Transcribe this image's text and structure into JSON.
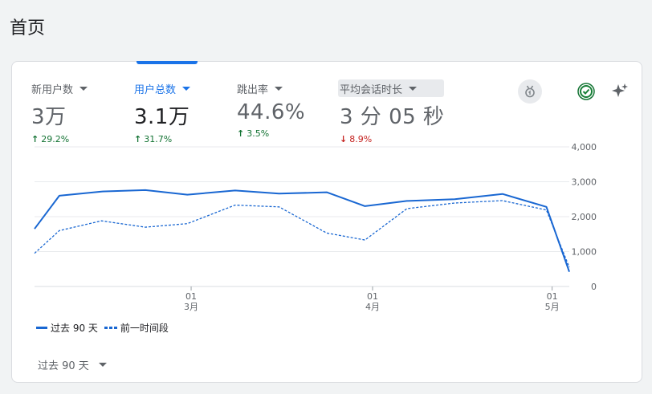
{
  "page": {
    "title": "首页"
  },
  "metrics": [
    {
      "label": "新用户数",
      "value": "3万",
      "change": "29.2%",
      "direction": "up"
    },
    {
      "label": "用户总数",
      "value": "3.1万",
      "change": "31.7%",
      "direction": "up"
    },
    {
      "label": "跳出率",
      "value": "44.6%",
      "change": "3.5%",
      "direction": "up"
    },
    {
      "label": "平均会话时长",
      "value": "3 分 05 秒",
      "change": "8.9%",
      "direction": "down"
    }
  ],
  "icons": {
    "medal": "medal-icon",
    "check": "check-circle-icon",
    "sparkle": "sparkle-icon"
  },
  "colors": {
    "accent": "#1a73e8",
    "line": "#1967d2",
    "up": "#137333",
    "down": "#c5221f"
  },
  "legend": {
    "current": "过去 90 天",
    "previous": "前一时间段"
  },
  "period": {
    "label": "过去 90 天"
  },
  "chart_data": {
    "type": "line",
    "ylim": [
      0,
      4000
    ],
    "yticks": [
      "4,000",
      "3,000",
      "2,000",
      "1,000",
      "0"
    ],
    "yticks_values": [
      4000,
      3000,
      2000,
      1000,
      0
    ],
    "xticks": [
      {
        "day": "01",
        "month": "3月",
        "index": 8.2
      },
      {
        "day": "01",
        "month": "4月",
        "index": 17.7
      },
      {
        "day": "01",
        "month": "5月",
        "index": 27.1
      }
    ],
    "grid": true,
    "series": [
      {
        "name": "过去 90 天",
        "style": "solid",
        "x": [
          0,
          1.3,
          3.5,
          5.8,
          8,
          10.5,
          12.8,
          15.3,
          17.3,
          19.5,
          22,
          24.5,
          26.8,
          28
        ],
        "values": [
          1650,
          2600,
          2720,
          2760,
          2630,
          2750,
          2660,
          2700,
          2300,
          2450,
          2500,
          2650,
          2280,
          420
        ]
      },
      {
        "name": "前一时间段",
        "style": "dashed",
        "x": [
          0,
          1.3,
          3.5,
          5.8,
          8,
          10.5,
          12.8,
          15.3,
          17.3,
          19.5,
          22,
          24.5,
          26.8,
          28
        ],
        "values": [
          950,
          1600,
          1880,
          1700,
          1800,
          2330,
          2280,
          1530,
          1330,
          2230,
          2390,
          2460,
          2190,
          550
        ]
      }
    ]
  }
}
